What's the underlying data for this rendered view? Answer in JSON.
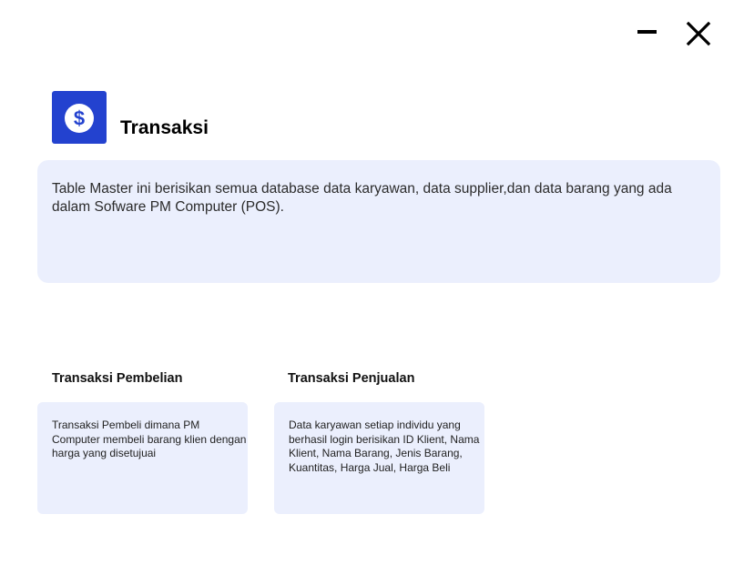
{
  "window": {
    "minimize_icon": "minus-icon",
    "close_icon": "close-icon"
  },
  "header": {
    "icon": "dollar-circle-icon",
    "icon_color": "#2342cf",
    "title": "Transaksi"
  },
  "description": {
    "text": "Table Master ini berisikan semua database data karyawan, data supplier,dan data barang yang ada dalam Sofware PM Computer (POS)."
  },
  "sections": [
    {
      "title": "Transaksi Pembelian",
      "description": "Transaksi Pembeli dimana PM Computer membeli barang klien dengan harga yang disetujuai"
    },
    {
      "title": "Transaksi Penjualan",
      "description": "Data karyawan setiap individu yang berhasil login berisikan ID Klient, Nama Klient, Nama Barang, Jenis Barang, Kuantitas, Harga Jual, Harga Beli"
    }
  ],
  "colors": {
    "panel_background": "#ebeffd",
    "accent": "#2342cf"
  }
}
